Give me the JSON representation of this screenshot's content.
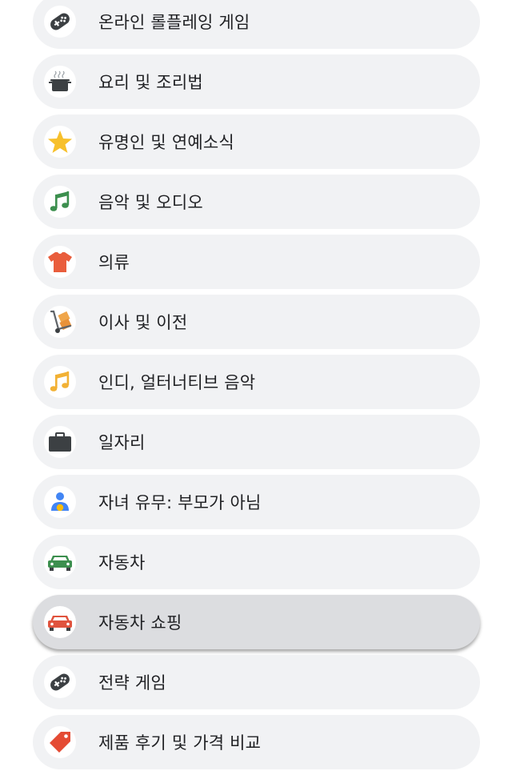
{
  "categories": [
    {
      "label": "온라인 롤플레잉 게임",
      "icon": "gamepad-icon",
      "selected": false
    },
    {
      "label": "요리 및 조리법",
      "icon": "cooking-pot-icon",
      "selected": false
    },
    {
      "label": "유명인 및 연예소식",
      "icon": "star-icon",
      "selected": false
    },
    {
      "label": "음악 및 오디오",
      "icon": "music-note-icon",
      "selected": false
    },
    {
      "label": "의류",
      "icon": "tshirt-icon",
      "selected": false
    },
    {
      "label": "이사 및 이전",
      "icon": "hand-truck-icon",
      "selected": false
    },
    {
      "label": "인디, 얼터너티브 음악",
      "icon": "music-note-icon",
      "selected": false
    },
    {
      "label": "일자리",
      "icon": "briefcase-icon",
      "selected": false
    },
    {
      "label": "자녀 유무: 부모가 아님",
      "icon": "person-icon",
      "selected": false
    },
    {
      "label": "자동차",
      "icon": "car-icon",
      "selected": false
    },
    {
      "label": "자동차 쇼핑",
      "icon": "car-icon",
      "selected": true
    },
    {
      "label": "전략 게임",
      "icon": "gamepad-icon",
      "selected": false
    },
    {
      "label": "제품 후기 및 가격 비교",
      "icon": "price-tag-icon",
      "selected": false
    }
  ],
  "colors": {
    "pill_background": "#f1f2f4",
    "pill_selected": "#dcdde0",
    "text": "#202124",
    "music_green": "#3c8f4e",
    "music_yellow": "#f2b134",
    "car_green": "#3c8f4e",
    "car_red": "#e0533e",
    "star": "#f7c02b",
    "shirt": "#e95d3c",
    "tag": "#e44b34",
    "dark": "#3c4043"
  }
}
